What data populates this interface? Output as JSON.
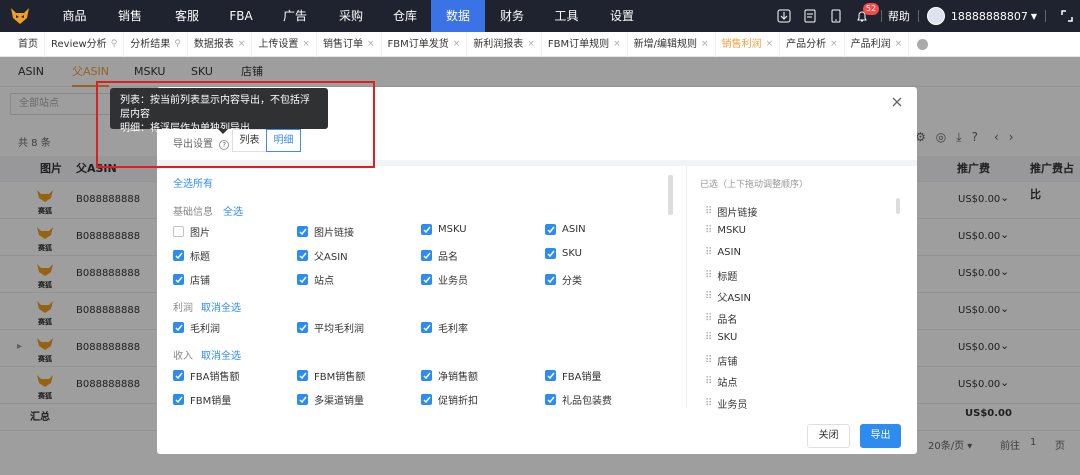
{
  "nav": {
    "items": [
      "商品",
      "销售",
      "客服",
      "FBA",
      "广告",
      "采购",
      "仓库",
      "数据",
      "财务",
      "工具",
      "设置"
    ],
    "active": "数据",
    "notifications": "52",
    "help": "帮助",
    "user": "18888888807"
  },
  "tabs": [
    {
      "label": "首页",
      "closable": false
    },
    {
      "label": "Review分析",
      "closable": false,
      "pinned": true
    },
    {
      "label": "分析结果",
      "closable": false,
      "pinned": true
    },
    {
      "label": "数据报表",
      "closable": true
    },
    {
      "label": "上传设置",
      "closable": true
    },
    {
      "label": "销售订单",
      "closable": true
    },
    {
      "label": "FBM订单发货",
      "closable": true
    },
    {
      "label": "新利润报表",
      "closable": true
    },
    {
      "label": "FBM订单规则",
      "closable": true
    },
    {
      "label": "新增/编辑规则",
      "closable": true
    },
    {
      "label": "销售利润",
      "closable": true,
      "active": true
    },
    {
      "label": "产品分析",
      "closable": true
    },
    {
      "label": "产品利润",
      "closable": true
    }
  ],
  "subtabs": [
    "ASIN",
    "父ASIN",
    "MSKU",
    "SKU",
    "店铺"
  ],
  "filter": {
    "placeholder": "全部站点"
  },
  "table": {
    "count": "共 8 条",
    "headers": {
      "image": "图片",
      "parent": "父ASIN",
      "fee": "推广费",
      "fee_ratio": "推广费占比"
    },
    "logo_text": "赛狐",
    "rows": [
      {
        "asin": "B088888888",
        "fee": "US$0.00"
      },
      {
        "asin": "B088888888",
        "fee": "US$0.00"
      },
      {
        "asin": "B088888888",
        "fee": "US$0.00"
      },
      {
        "asin": "B088888888",
        "fee": "US$0.00"
      },
      {
        "asin": "B088888888",
        "fee": "US$0.00"
      },
      {
        "asin": "B088888888",
        "fee": "US$0.00"
      }
    ],
    "summary_label": "汇总",
    "summary_fee": "US$0.00"
  },
  "tooltip": {
    "line1": "列表：按当前列表显示内容导出，不包括浮层内容",
    "line2": "明细：将浮层作为单独列导出"
  },
  "modal": {
    "export_label": "导出设置",
    "seg_list": "列表",
    "seg_detail": "明细",
    "select_all": "全选所有",
    "sections": [
      {
        "title": "基础信息",
        "action": "全选",
        "items": [
          {
            "label": "图片",
            "checked": false
          },
          {
            "label": "图片链接",
            "checked": true
          },
          {
            "label": "MSKU",
            "checked": true
          },
          {
            "label": "ASIN",
            "checked": true
          },
          {
            "label": "标题",
            "checked": true
          },
          {
            "label": "父ASIN",
            "checked": true
          },
          {
            "label": "品名",
            "checked": true
          },
          {
            "label": "SKU",
            "checked": true
          },
          {
            "label": "店铺",
            "checked": true
          },
          {
            "label": "站点",
            "checked": true
          },
          {
            "label": "业务员",
            "checked": true
          },
          {
            "label": "分类",
            "checked": true
          }
        ]
      },
      {
        "title": "利润",
        "action": "取消全选",
        "items": [
          {
            "label": "毛利润",
            "checked": true
          },
          {
            "label": "平均毛利润",
            "checked": true
          },
          {
            "label": "毛利率",
            "checked": true
          }
        ]
      },
      {
        "title": "收入",
        "action": "取消全选",
        "items": [
          {
            "label": "FBA销售额",
            "checked": true
          },
          {
            "label": "FBM销售额",
            "checked": true
          },
          {
            "label": "净销售额",
            "checked": true
          },
          {
            "label": "FBA销量",
            "checked": true
          },
          {
            "label": "FBM销量",
            "checked": true
          },
          {
            "label": "多渠道销量",
            "checked": true
          },
          {
            "label": "促销折扣",
            "checked": true
          },
          {
            "label": "礼品包装费",
            "checked": true
          }
        ]
      }
    ],
    "selected_title": "已选（上下拖动调整顺序）",
    "selected": [
      "图片链接",
      "MSKU",
      "ASIN",
      "标题",
      "父ASIN",
      "品名",
      "SKU",
      "店铺",
      "站点",
      "业务员"
    ],
    "close": "关闭",
    "export": "导出"
  },
  "pagination": {
    "page_size": "20条/页",
    "goto": "前往",
    "page": "1",
    "unit": "页"
  },
  "colors": {
    "nav_bg": "#1f2330",
    "active": "#3b73e6",
    "accent": "#f4a13c",
    "link": "#2d8cf0"
  }
}
